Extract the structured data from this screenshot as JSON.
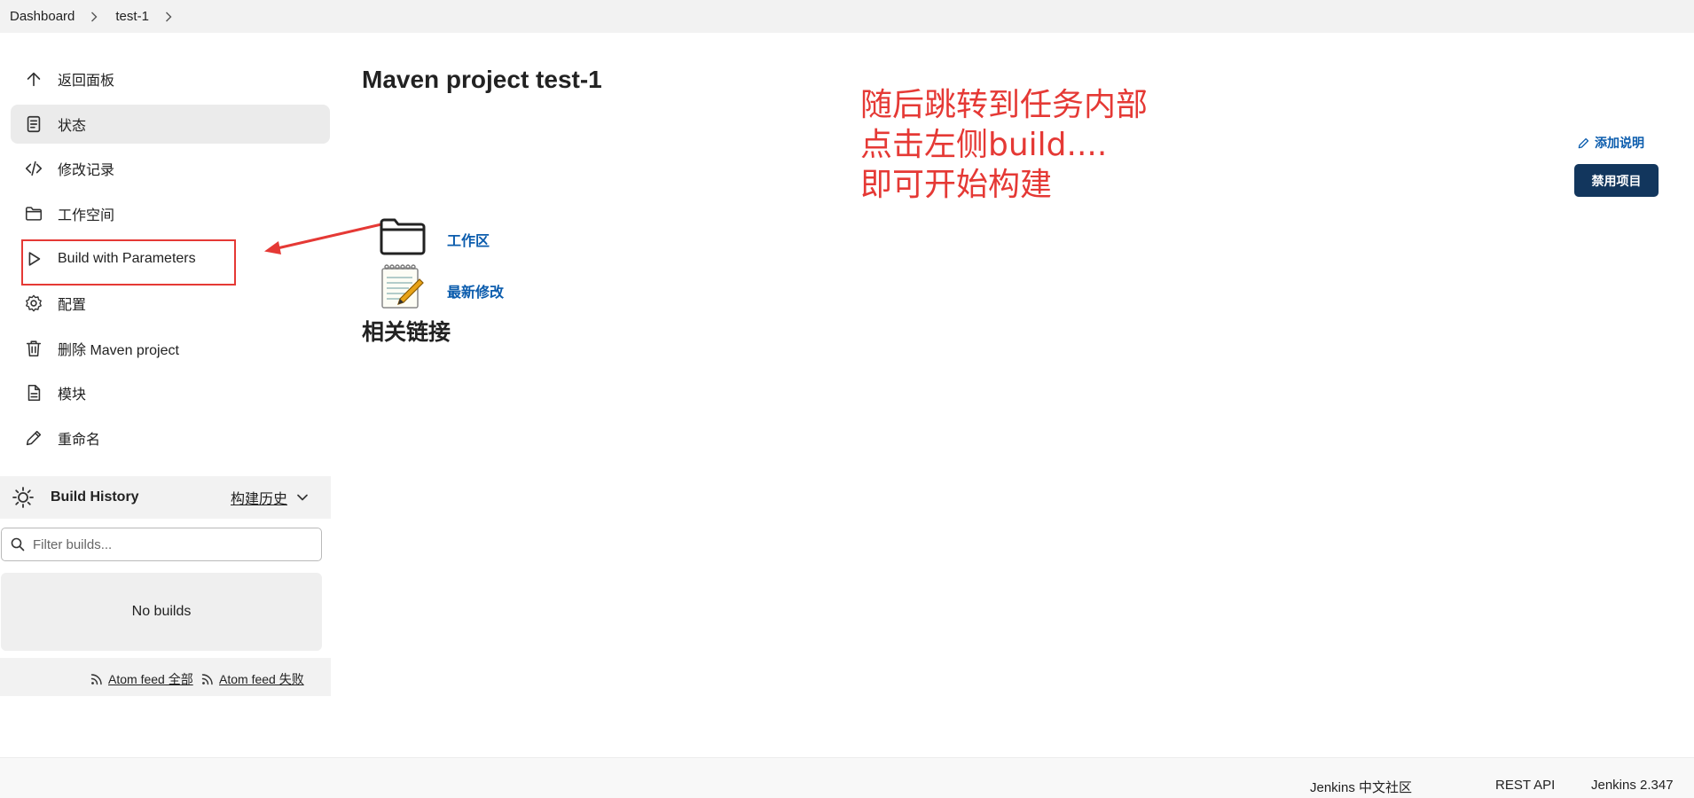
{
  "breadcrumb": {
    "items": [
      "Dashboard",
      "test-1"
    ]
  },
  "sidebar": {
    "items": [
      {
        "label": "返回面板",
        "icon": "arrow-up-icon"
      },
      {
        "label": "状态",
        "icon": "document-icon",
        "active": true
      },
      {
        "label": "修改记录",
        "icon": "code-icon"
      },
      {
        "label": "工作空间",
        "icon": "folder-icon"
      },
      {
        "label": "Build with Parameters",
        "icon": "play-icon"
      },
      {
        "label": "配置",
        "icon": "gear-icon"
      },
      {
        "label": "删除 Maven project",
        "icon": "trash-icon"
      },
      {
        "label": "模块",
        "icon": "file-icon"
      },
      {
        "label": "重命名",
        "icon": "pencil-icon"
      }
    ]
  },
  "build_history": {
    "title": "Build History",
    "trend": "构建历史",
    "filter_placeholder": "Filter builds...",
    "empty": "No builds",
    "atom_all": "Atom feed 全部",
    "atom_failed": "Atom feed 失败"
  },
  "main": {
    "title": "Maven project test-1",
    "add_description": "添加说明",
    "disable_button": "禁用项目",
    "links": [
      {
        "label": "工作区",
        "icon": "folder-icon"
      },
      {
        "label": "最新修改",
        "icon": "notepad-icon"
      }
    ],
    "related_links_title": "相关链接"
  },
  "annotation": {
    "lines": [
      "随后跳转到任务内部",
      "点击左侧build....",
      "即可开始构建"
    ],
    "color": "#e53935"
  },
  "footer": {
    "community": "Jenkins 中文社区",
    "rest_api": "REST API",
    "version": "Jenkins 2.347"
  },
  "colors": {
    "link": "#0b5cad",
    "primary_button": "#12365d",
    "annotation": "#e53935"
  }
}
